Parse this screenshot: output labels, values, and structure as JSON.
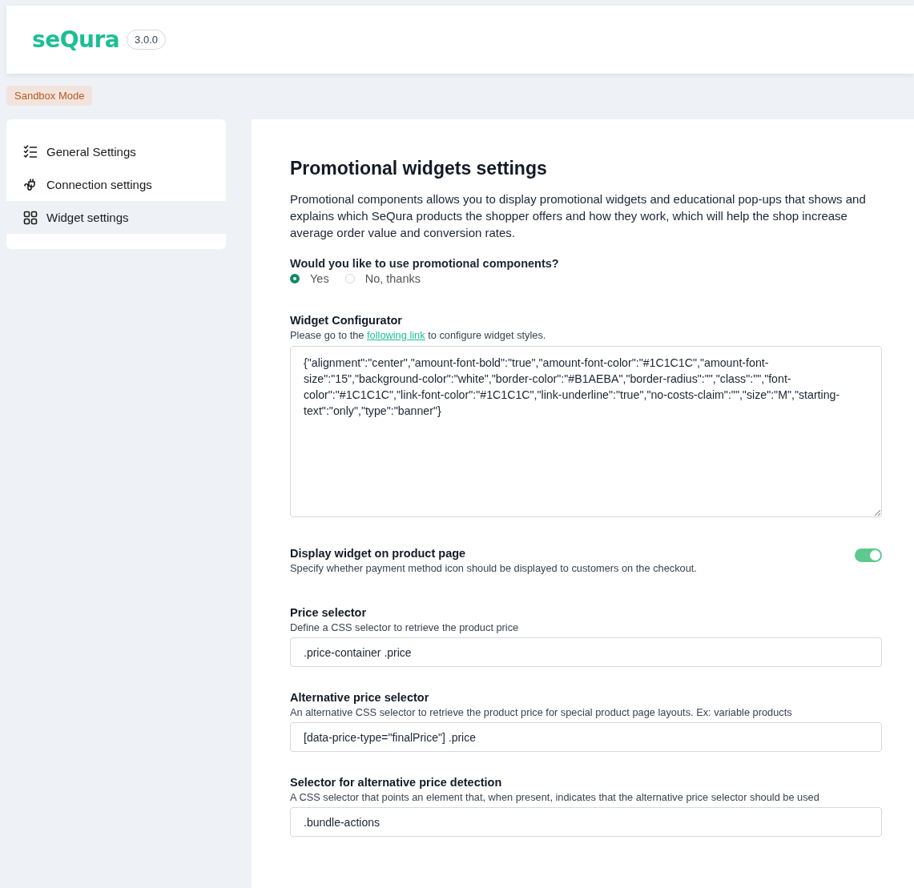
{
  "header": {
    "logo": "seQura",
    "version": "3.0.0"
  },
  "mode_badge": "Sandbox Mode",
  "sidebar": {
    "items": [
      {
        "label": "General Settings",
        "kind": "checklist",
        "selected": false
      },
      {
        "label": "Connection settings",
        "kind": "plug",
        "selected": false
      },
      {
        "label": "Widget settings",
        "kind": "grid",
        "selected": true
      }
    ]
  },
  "page": {
    "title": "Promotional widgets settings",
    "description": "Promotional components allows you to display promotional widgets and educational pop-ups that shows and explains which SeQura products the shopper offers and how they work, which will help the shop increase average order value and conversion rates.",
    "use_components": {
      "question": "Would you like to use promotional components?",
      "options": [
        {
          "label": "Yes",
          "selected": true
        },
        {
          "label": "No, thanks",
          "selected": false
        }
      ]
    },
    "configurator": {
      "label": "Widget Configurator",
      "hint_before": "Please go to the ",
      "link": "following link",
      "hint_after": " to configure widget styles.",
      "value": "{\"alignment\":\"center\",\"amount-font-bold\":\"true\",\"amount-font-color\":\"#1C1C1C\",\"amount-font-size\":\"15\",\"background-color\":\"white\",\"border-color\":\"#B1AEBA\",\"border-radius\":\"\",\"class\":\"\",\"font-color\":\"#1C1C1C\",\"link-font-color\":\"#1C1C1C\",\"link-underline\":\"true\",\"no-costs-claim\":\"\",\"size\":\"M\",\"starting-text\":\"only\",\"type\":\"banner\"}"
    },
    "display_toggle": {
      "label": "Display widget on product page",
      "hint": "Specify whether payment method icon should be displayed to customers on the checkout.",
      "on": true
    },
    "fields": [
      {
        "label": "Price selector",
        "hint": "Define a CSS selector to retrieve the product price",
        "value": ".price-container .price"
      },
      {
        "label": "Alternative price selector",
        "hint": "An alternative CSS selector to retrieve the product price for special product page layouts. Ex: variable products",
        "value": "[data-price-type=\"finalPrice\"] .price"
      },
      {
        "label": "Selector for alternative price detection",
        "hint": "A CSS selector that points an element that, when present, indicates that the alternative price selector should be used",
        "value": ".bundle-actions"
      }
    ]
  }
}
